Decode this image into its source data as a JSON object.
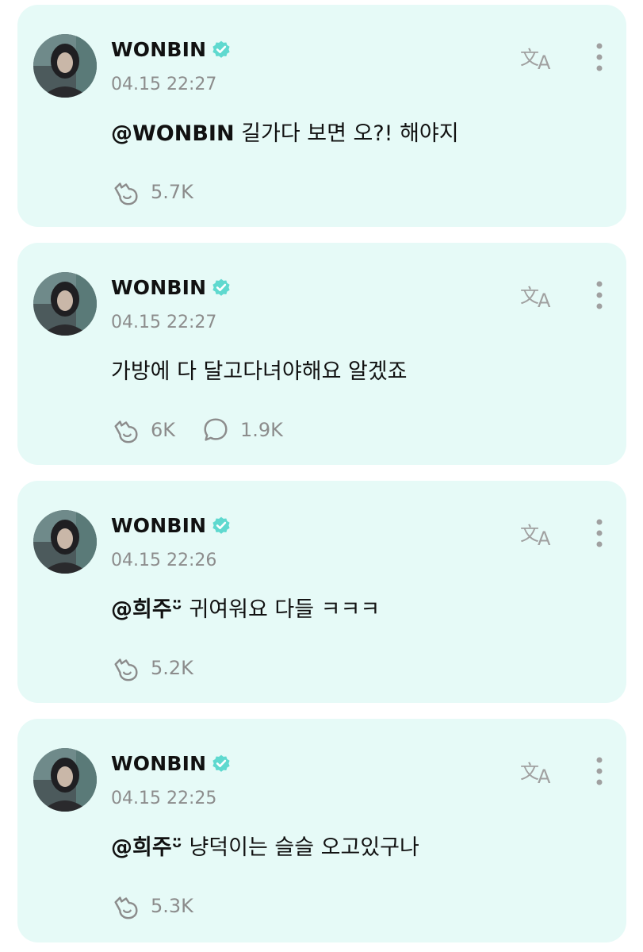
{
  "posts": [
    {
      "author": "WONBIN",
      "timestamp": "04.15 22:27",
      "mention": "@WONBIN",
      "text": " 길가다 보면 오?! 해야지",
      "likes": "5.7K"
    },
    {
      "author": "WONBIN",
      "timestamp": "04.15 22:27",
      "mention": "",
      "text": "가방에 다 달고다녀야해요 알겠죠",
      "likes": "6K",
      "comments": "1.9K"
    },
    {
      "author": "WONBIN",
      "timestamp": "04.15 22:26",
      "mention": "@희주ᵕ̈",
      "text": " 귀여워요 다들 ㅋㅋㅋ",
      "likes": "5.2K"
    },
    {
      "author": "WONBIN",
      "timestamp": "04.15 22:25",
      "mention": "@희주ᵕ̈",
      "text": " 냥덕이는 슬슬 오고있구나",
      "likes": "5.3K"
    }
  ],
  "icons": {
    "verified": "verified-badge-icon",
    "translate": "translate-icon",
    "more": "more-vertical-icon",
    "like": "like-icon",
    "comment": "comment-icon"
  },
  "colors": {
    "card_background": "#e6faf7",
    "accent": "#5fd9cf",
    "meta_text": "#8c8c8c",
    "icon_gray": "#a0a0a0"
  }
}
